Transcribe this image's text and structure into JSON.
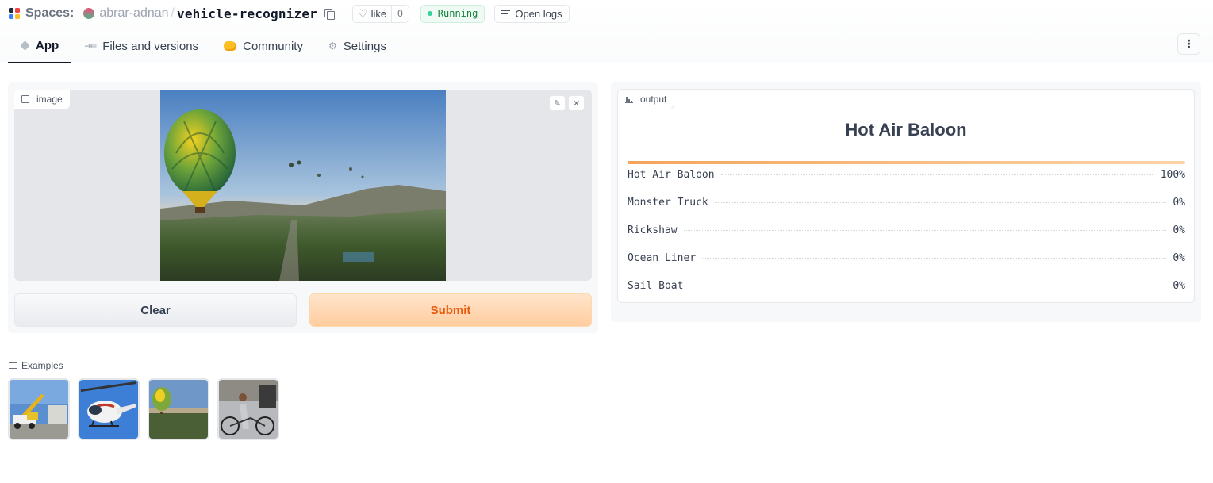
{
  "header": {
    "spaces_label": "Spaces:",
    "owner": "abrar-adnan",
    "separator": "/",
    "space_name": "vehicle-recognizer",
    "like_label": "like",
    "like_count": "0",
    "status": "Running",
    "logs_label": "Open logs"
  },
  "tabs": [
    {
      "label": "App",
      "icon": "cube-icon"
    },
    {
      "label": "Files and versions",
      "icon": "files-icon"
    },
    {
      "label": "Community",
      "icon": "community-icon"
    },
    {
      "label": "Settings",
      "icon": "gear-icon"
    }
  ],
  "input": {
    "label": "image",
    "clear_label": "Clear",
    "submit_label": "Submit"
  },
  "output": {
    "label": "output",
    "top_label": "Hot Air Baloon",
    "confidences": [
      {
        "label": "Hot Air Baloon",
        "percent": "100%",
        "value": 1.0
      },
      {
        "label": "Monster Truck",
        "percent": "0%",
        "value": 0.0
      },
      {
        "label": "Rickshaw",
        "percent": "0%",
        "value": 0.0
      },
      {
        "label": "Ocean Liner",
        "percent": "0%",
        "value": 0.0
      },
      {
        "label": "Sail Boat",
        "percent": "0%",
        "value": 0.0
      }
    ]
  },
  "examples": {
    "label": "Examples",
    "items": [
      "crane-truck-example",
      "helicopter-example",
      "hot-air-balloon-example",
      "rickshaw-example"
    ]
  },
  "colors": {
    "accent": "#ea580c",
    "running": "#15803d"
  }
}
